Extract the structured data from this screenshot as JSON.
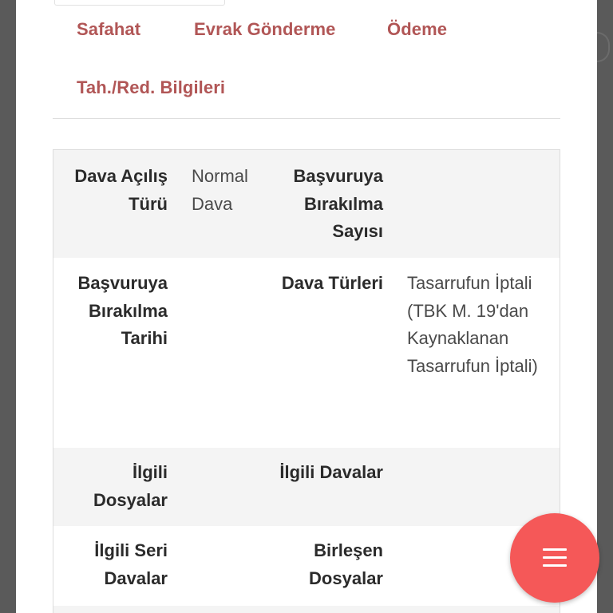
{
  "tabs": {
    "safahat": "Safahat",
    "evrak_gonderme": "Evrak Gönderme",
    "odeme": "Ödeme",
    "tah_red": "Tah./Red. Bilgileri"
  },
  "details": {
    "dava_acilis_turu_label": "Dava Açılış Türü",
    "dava_acilis_turu_value": "Normal Dava",
    "basvuruya_birakilma_sayisi_label": "Başvuruya Bırakılma Sayısı",
    "basvuruya_birakilma_sayisi_value": "",
    "basvuruya_birakilma_tarihi_label": "Başvuruya Bırakılma Tarihi",
    "basvuruya_birakilma_tarihi_value": "",
    "dava_turleri_label": "Dava Türleri",
    "dava_turleri_value": "Tasarrufun İptali (TBK M. 19'dan Kaynaklanan Tasarrufun İptali)",
    "ilgili_dosyalar_label": "İlgili Dosyalar",
    "ilgili_dosyalar_value": "",
    "ilgili_davalar_label": "İlgili Davalar",
    "ilgili_davalar_value": "",
    "ilgili_seri_davalar_label": "İlgili Seri Davalar",
    "ilgili_seri_davalar_value": "",
    "birlesen_dosyalar_label": "Birleşen Dosyalar",
    "birlesen_dosyalar_value": ""
  },
  "fab": {
    "icon": "hamburger-menu-icon",
    "color": "#f55858"
  },
  "colors": {
    "tab_text": "#b15656",
    "row_shade": "#f4f4f4"
  }
}
